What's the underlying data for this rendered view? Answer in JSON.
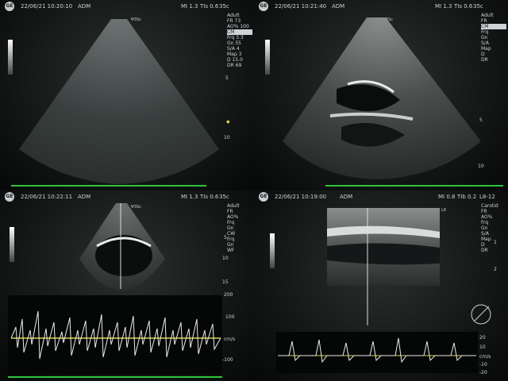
{
  "panels": [
    {
      "logo": "GE",
      "date": "22/06/21 10:20:10",
      "user": "ADM",
      "mi": "MI 1.3",
      "tis": "TIs 0.6",
      "fps": "35c",
      "side": [
        "Adult",
        "FR 73",
        "AO% 100",
        "CM",
        "Frq 3.3",
        "Gn 55",
        "S/A 4",
        "Map 3",
        "D 15.0",
        "DR 69"
      ],
      "depth_labels": [
        "5",
        "10"
      ],
      "probe_label": "Ψ3Sc"
    },
    {
      "logo": "GE",
      "date": "22/06/21 10:21:40",
      "user": "ADM",
      "mi": "MI 1.3",
      "tis": "TIs 0.6",
      "fps": "35c",
      "side": [
        "Adult",
        "FR",
        "CM",
        "Frq",
        "Gn",
        "S/A",
        "Map",
        "D",
        "DR"
      ],
      "depth_labels": [
        "5",
        "10"
      ],
      "probe_label": "Ψ3Sc"
    },
    {
      "logo": "GE",
      "date": "22/06/21 10:22:11",
      "user": "ADM",
      "mi": "MI 1.3",
      "tis": "TIs 0.6",
      "fps": "35c",
      "side": [
        "Adult",
        "FR",
        "AO%",
        "Frq",
        "Gn",
        "CW",
        "Frq",
        "Gn",
        "WF"
      ],
      "depth_labels": [
        "5",
        "10",
        "15"
      ],
      "doppler_scale": [
        "200",
        "100",
        "cm/s",
        "-100"
      ],
      "probe_label": "Ψ3Sc"
    },
    {
      "logo": "GE",
      "date": "22/06/21 10:19:00",
      "user": "ADM",
      "mi": "MI 0.8",
      "tis": "TIb 0.2",
      "fps": "L8-12",
      "side": [
        "Carotid",
        "FR",
        "AO%",
        "Frq",
        "Gn",
        "S/A",
        "Map",
        "D",
        "DR"
      ],
      "depth_labels": [
        "1",
        "2"
      ],
      "doppler_scale": [
        "20",
        "10",
        "cm/s",
        "-10",
        "-20"
      ],
      "probe_label": "L8"
    }
  ]
}
